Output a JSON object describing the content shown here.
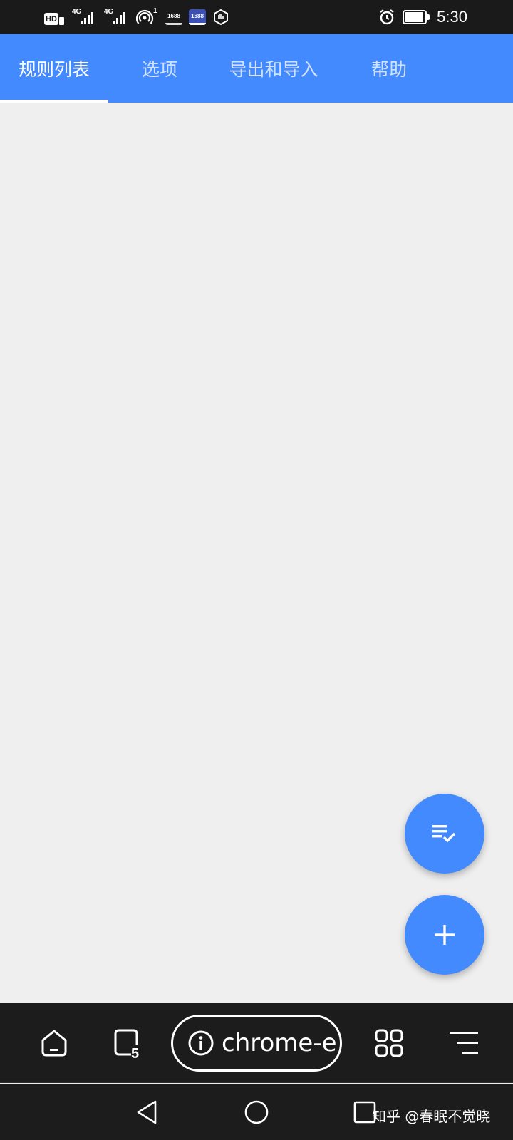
{
  "status_bar": {
    "hd_label": "HD",
    "network_1": "4G",
    "network_2": "4G",
    "hotspot_count": "1",
    "app_badge_1": "1688",
    "app_badge_2": "1688",
    "time": "5:30"
  },
  "tabs": [
    {
      "label": "规则列表",
      "active": true
    },
    {
      "label": "选项",
      "active": false
    },
    {
      "label": "导出和导入",
      "active": false
    },
    {
      "label": "帮助",
      "active": false
    }
  ],
  "browser_toolbar": {
    "tab_count": "5",
    "url_text": "chrome-e"
  },
  "watermark": "知乎 @春眠不觉晓",
  "colors": {
    "primary": "#448aff",
    "status_bar_bg": "#1a1a1a",
    "content_bg": "#efefef",
    "toolbar_bg": "#1c1c1c"
  },
  "icons": {
    "fab_top": "playlist-check-icon",
    "fab_bottom": "plus-icon",
    "toolbar": [
      "home-icon",
      "tabs-icon",
      "info-icon",
      "apps-grid-icon",
      "menu-icon"
    ],
    "nav": [
      "back-icon",
      "home-circle-icon",
      "recents-icon"
    ]
  }
}
